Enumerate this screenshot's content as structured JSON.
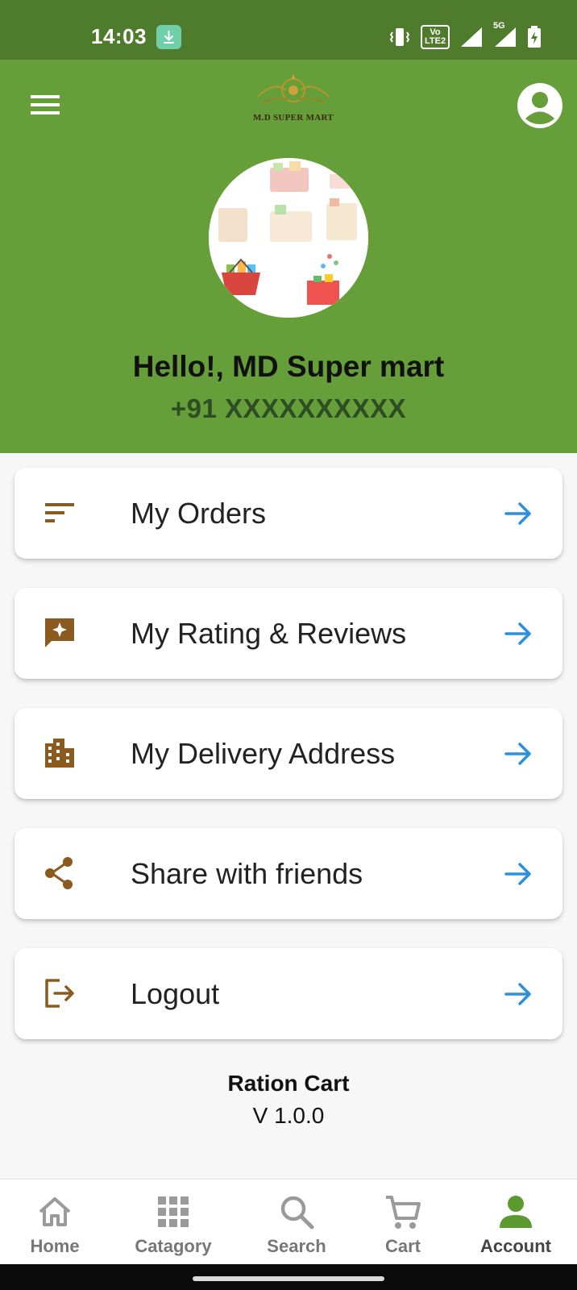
{
  "status_bar": {
    "time": "14:03",
    "icons": [
      "download-icon",
      "vibrate-icon",
      "volte-icon",
      "signal-icon",
      "5g-signal-icon",
      "battery-charging-icon"
    ],
    "volte_text": "Vo LTE2",
    "network_text": "5G"
  },
  "header": {
    "logo_text": "M.D SUPER MART",
    "greeting": "Hello!, MD Super mart",
    "phone": "+91 XXXXXXXXXX"
  },
  "menu": {
    "items": [
      {
        "label": "My Orders",
        "icon": "sort-lines-icon"
      },
      {
        "label": "My Rating & Reviews",
        "icon": "review-star-icon"
      },
      {
        "label": "My Delivery Address",
        "icon": "building-icon"
      },
      {
        "label": "Share with friends",
        "icon": "share-icon"
      },
      {
        "label": "Logout",
        "icon": "logout-icon"
      }
    ]
  },
  "footer": {
    "app_name": "Ration Cart",
    "version": "V 1.0.0"
  },
  "bottom_nav": {
    "items": [
      {
        "label": "Home",
        "icon": "home-icon"
      },
      {
        "label": "Catagory",
        "icon": "grid-icon"
      },
      {
        "label": "Search",
        "icon": "search-icon"
      },
      {
        "label": "Cart",
        "icon": "cart-icon"
      },
      {
        "label": "Account",
        "icon": "person-icon"
      }
    ],
    "active": "Account"
  },
  "colors": {
    "header_green": "#669e3a",
    "status_green": "#4f7c2c",
    "icon_brown": "#8a5a1e",
    "arrow_blue": "#2b90e0",
    "active_green": "#5a9a2e",
    "inactive_gray": "#9a9a9a"
  }
}
